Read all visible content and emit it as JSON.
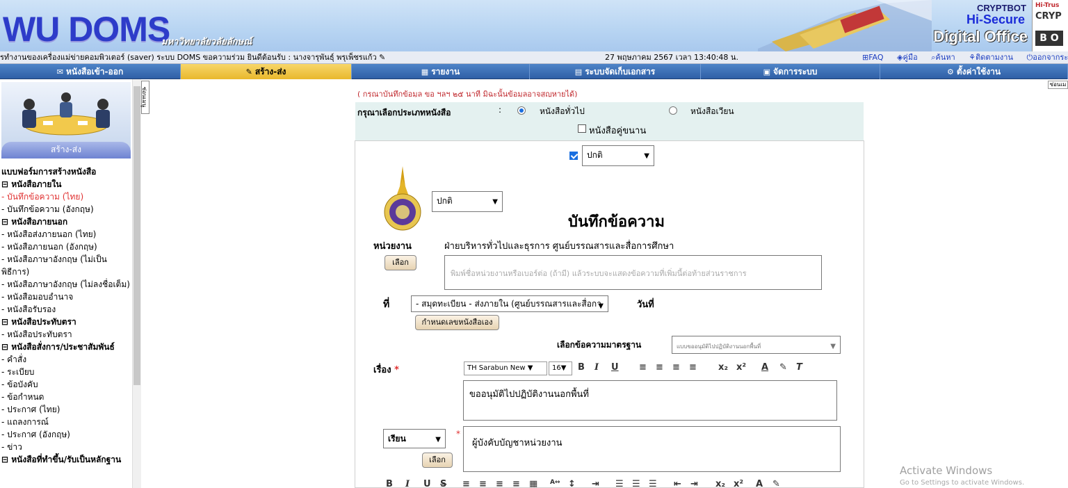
{
  "header": {
    "logo_text": "WU DOMS",
    "university": "มหาวิทยาลัยวลัยลักษณ์",
    "brand_line1": "CRYPTBOT",
    "brand_line2": "Hi-Secure",
    "brand_line3": "Digital Office",
    "corner_top": "Hi-Trus",
    "corner_mid": "CRYP",
    "corner_bottom": "B O"
  },
  "status": {
    "left": "รทำงานของเครื่องแม่ข่ายคอมพิวเตอร์ (saver) ระบบ DOMS ขอความร่วม ยินดีต้อนรับ :",
    "user": "นางจารุพันธุ์ พรุเพ็ชรแก้ว",
    "date": "27 พฤษภาคม 2567 เวลา 13:40:48 น.",
    "links": [
      "FAQ",
      "คู่มือ",
      "ค้นหา",
      "ติดตามงาน",
      "ออกจากระ"
    ]
  },
  "nav": {
    "items": [
      {
        "label": "หนังสือเข้า-ออก",
        "icon": "✉"
      },
      {
        "label": "สร้าง-ส่ง",
        "icon": "✎"
      },
      {
        "label": "รายงาน",
        "icon": "▦"
      },
      {
        "label": "ระบบจัดเก็บเอกสาร",
        "icon": "▤"
      },
      {
        "label": "จัดการระบบ",
        "icon": "▣"
      },
      {
        "label": "ตั้งค่าใช้งาน",
        "icon": "⚙"
      }
    ]
  },
  "sidebar": {
    "title": "สร้าง-ส่ง",
    "heading": "แบบฟอร์มการสร้างหนังสือ",
    "tab": "ซ่อนเมนู",
    "items": [
      {
        "text": "⊟ หนังสือภายใน",
        "kind": "group"
      },
      {
        "text": "- บันทึกข้อความ (ไทย)",
        "kind": "sel"
      },
      {
        "text": "- บันทึกข้อความ (อังกฤษ)",
        "kind": "item"
      },
      {
        "text": "⊟ หนังสือภายนอก",
        "kind": "group"
      },
      {
        "text": "- หนังสือส่งภายนอก (ไทย)",
        "kind": "item"
      },
      {
        "text": "- หนังสือภายนอก (อังกฤษ)",
        "kind": "item"
      },
      {
        "text": "- หนังสือภาษาอังกฤษ (ไม่เป็นพิธีการ)",
        "kind": "item"
      },
      {
        "text": "- หนังสือภาษาอังกฤษ (ไม่ลงชื่อเต็ม)",
        "kind": "item"
      },
      {
        "text": "- หนังสือมอบอำนาจ",
        "kind": "item"
      },
      {
        "text": "- หนังสือรับรอง",
        "kind": "item"
      },
      {
        "text": "⊟ หนังสือประทับตรา",
        "kind": "group"
      },
      {
        "text": "- หนังสือประทับตรา",
        "kind": "item"
      },
      {
        "text": "⊟ หนังสือสั่งการ/ประชาสัมพันธ์",
        "kind": "group"
      },
      {
        "text": "- คำสั่ง",
        "kind": "item"
      },
      {
        "text": "- ระเบียบ",
        "kind": "item"
      },
      {
        "text": "- ข้อบังคับ",
        "kind": "item"
      },
      {
        "text": "- ข้อกำหนด",
        "kind": "item"
      },
      {
        "text": "- ประกาศ (ไทย)",
        "kind": "item"
      },
      {
        "text": "- แถลงการณ์",
        "kind": "item"
      },
      {
        "text": "- ประกาศ (อังกฤษ)",
        "kind": "item"
      },
      {
        "text": "- ข่าว",
        "kind": "item"
      },
      {
        "text": "⊟ หนังสือที่ทำขึ้น/รับเป็นหลักฐาน",
        "kind": "group"
      }
    ]
  },
  "main": {
    "tab": "ซ่อนเม",
    "notice": "(   กรุณาบันทึกข้อมูล ขอ ฯลฯ ๒๕ นาที มิฉะนั้นข้อมูลอาจสูญหายได้)",
    "type_label": "กรุณาเลือกประเภทหนังสือ",
    "colon": ":",
    "radio_general": "หนังสือทั่วไป",
    "radio_circular": "หนังสือเวียน",
    "pair_label": "หนังสือคู่ขนาน"
  },
  "form": {
    "urgency": "ปกติ",
    "secrecy": "ปกติ",
    "title": "บันทึกข้อความ",
    "dept_label": "หน่วยงาน",
    "dept_value": "ฝ่ายบริหารทั่วไปและธุรการ ศูนย์บรรณสารและสื่อการศึกษา",
    "select_btn": "เลือก",
    "dept_placeholder": "พิมพ์ชื่อหน่วยงานหรือเบอร์ต่อ (ถ้ามี) แล้วระบบจะแสดงข้อความที่เพิ่มนี้ต่อท้ายส่วนราชการ",
    "no_label": "ที่",
    "no_value": "- สมุดทะเบียน - ส่งภายใน (ศูนย์บรรณสารและสื่อกา",
    "date_label": "วันที่",
    "no_btn": "กำหนดเลขหนังสือเอง",
    "std_label": "เลือกข้อความมาตรฐาน",
    "std_value": "แบบขออนุมัติไปปฏิบัติงานนอกพื้นที่",
    "subj_label": "เรื่อง",
    "req": "*",
    "font": "TH Sarabun New",
    "font_size": "16",
    "subject": "ขออนุมัติไปปฏิบัติงานนอกพื้นที่",
    "to_value": "เรียน",
    "to_text": "ผู้บังคับบัญชาหน่วยงาน"
  },
  "windows": {
    "line1": "Activate Windows",
    "line2": "Go to Settings to activate Windows."
  }
}
